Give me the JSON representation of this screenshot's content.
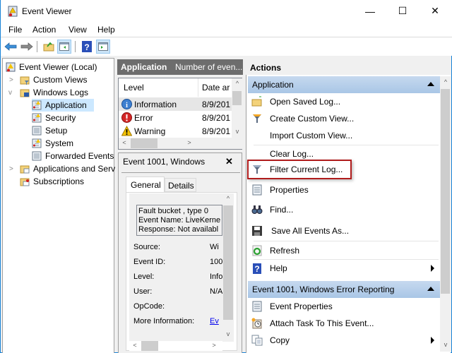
{
  "window": {
    "title": "Event Viewer",
    "controls": {
      "minimize": "—",
      "maximize": "☐",
      "close": "✕"
    }
  },
  "menubar": [
    "File",
    "Action",
    "View",
    "Help"
  ],
  "toolbar": {
    "buttons": [
      "back-arrow",
      "forward-arrow",
      "open-folder",
      "show-hide-console-tree",
      "help",
      "show-hide-action-pane"
    ]
  },
  "tree": {
    "root": "Event Viewer (Local)",
    "items": [
      {
        "label": "Custom Views",
        "level": 1,
        "expander": ">"
      },
      {
        "label": "Windows Logs",
        "level": 1,
        "expander": "v"
      },
      {
        "label": "Application",
        "level": 2,
        "selected": true
      },
      {
        "label": "Security",
        "level": 2
      },
      {
        "label": "Setup",
        "level": 2
      },
      {
        "label": "System",
        "level": 2
      },
      {
        "label": "Forwarded Events",
        "level": 2
      },
      {
        "label": "Applications and Serv",
        "level": 1,
        "expander": ">"
      },
      {
        "label": "Subscriptions",
        "level": 1
      }
    ]
  },
  "middle": {
    "header_title": "Application",
    "header_subtitle": "Number of even...",
    "columns": [
      "Level",
      "Date ar"
    ],
    "rows": [
      {
        "level": "Information",
        "date": "8/9/201",
        "icon": "info"
      },
      {
        "level": "Error",
        "date": "8/9/201",
        "icon": "error"
      },
      {
        "level": "Warning",
        "date": "8/9/201",
        "icon": "warning"
      }
    ],
    "detail_title": "Event 1001, Windows",
    "detail_close": "✕",
    "tabs": [
      "General",
      "Details"
    ],
    "message_lines": [
      "Fault bucket , type 0",
      "Event Name: LiveKerne",
      "Response: Not availabl"
    ],
    "fields": [
      {
        "label": "Source:",
        "value": "Wi"
      },
      {
        "label": "Event ID:",
        "value": "100"
      },
      {
        "label": "Level:",
        "value": "Info"
      },
      {
        "label": "User:",
        "value": "N/A"
      },
      {
        "label": "OpCode:",
        "value": ""
      },
      {
        "label": "More Information:",
        "value": "Ev"
      }
    ]
  },
  "actions": {
    "header": "Actions",
    "section1": "Application",
    "section1_items": [
      {
        "label": "Open Saved Log...",
        "icon": "open-folder"
      },
      {
        "label": "Create Custom View...",
        "icon": "filter-add"
      },
      {
        "label": "Import Custom View...",
        "icon": ""
      },
      {
        "label": "Clear Log...",
        "icon": ""
      },
      {
        "label": "Filter Current Log...",
        "icon": "filter"
      },
      {
        "label": "Properties",
        "icon": "properties"
      },
      {
        "label": "Find...",
        "icon": "binoculars"
      },
      {
        "label": "Save All Events As...",
        "icon": "floppy"
      },
      {
        "label": "Refresh",
        "icon": "refresh"
      },
      {
        "label": "Help",
        "icon": "help",
        "submenu": true
      }
    ],
    "section2": "Event 1001, Windows Error Reporting",
    "section2_items": [
      {
        "label": "Event Properties",
        "icon": "properties"
      },
      {
        "label": "Attach Task To This Event...",
        "icon": "task-clock"
      },
      {
        "label": "Copy",
        "icon": "copy",
        "submenu": true
      }
    ]
  },
  "highlight": {
    "target": "Filter Current Log...",
    "color": "#b01c1c"
  }
}
